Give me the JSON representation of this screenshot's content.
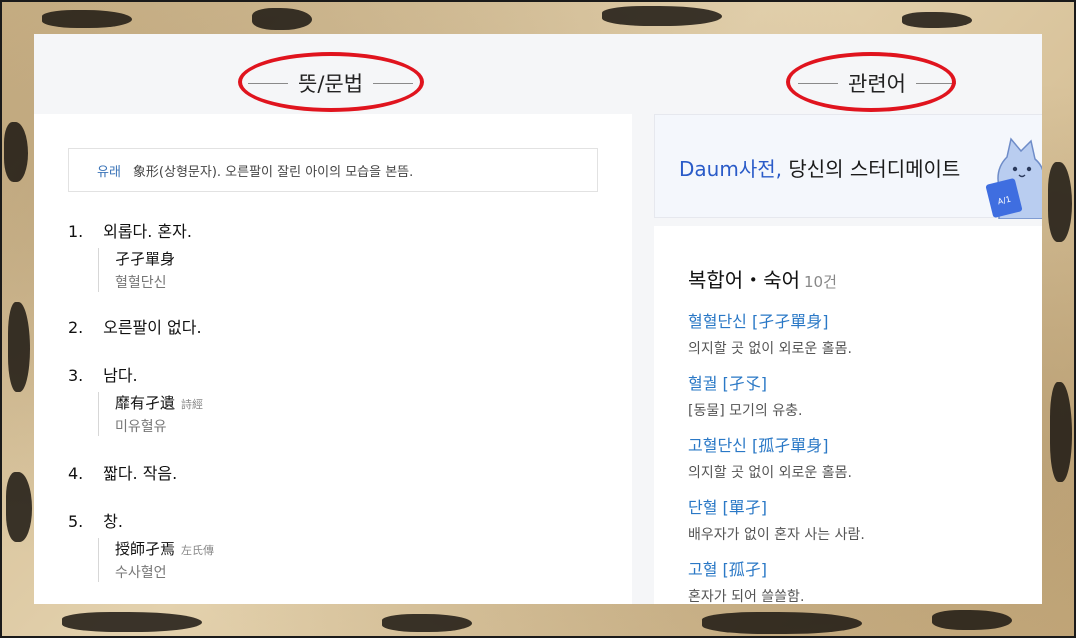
{
  "headers": {
    "meaning": "뜻/문법",
    "related": "관련어"
  },
  "origin": {
    "tag": "유래",
    "text": "象形(상형문자). 오른팔이 잘린 아이의 모습을 본뜸."
  },
  "definitions": [
    {
      "num": "1.",
      "text": "외롭다. 혼자.",
      "example": {
        "hanja": "孑孑單身",
        "source": "",
        "reading": "혈혈단신"
      }
    },
    {
      "num": "2.",
      "text": "오른팔이 없다."
    },
    {
      "num": "3.",
      "text": "남다.",
      "example": {
        "hanja": "靡有孑遺",
        "source": "詩經",
        "reading": "미유혈유"
      }
    },
    {
      "num": "4.",
      "text": "짧다. 작음."
    },
    {
      "num": "5.",
      "text": "창.",
      "example": {
        "hanja": "授師孑焉",
        "source": "左氏傳",
        "reading": "수사혈언"
      }
    }
  ],
  "promo": {
    "brand": "Daum사전,",
    "tagline": " 당신의 스터디메이트",
    "badge": "A/1"
  },
  "related": {
    "title": "복합어・숙어",
    "count": "10건",
    "items": [
      {
        "word": "혈혈단신 [孑孑單身]",
        "meaning": "의지할 곳 없이 외로운 홀몸."
      },
      {
        "word": "혈궐 [孑孓]",
        "meaning": "[동물] 모기의 유충."
      },
      {
        "word": "고혈단신 [孤孑單身]",
        "meaning": "의지할 곳 없이 외로운 홀몸."
      },
      {
        "word": "단혈 [單孑]",
        "meaning": "배우자가 없이 혼자 사는 사람."
      },
      {
        "word": "고혈 [孤孑]",
        "meaning": "혼자가 되어 쓸쓸함."
      }
    ]
  },
  "colors": {
    "accent_blue": "#2a78c6",
    "highlight_red": "#e0141e"
  }
}
